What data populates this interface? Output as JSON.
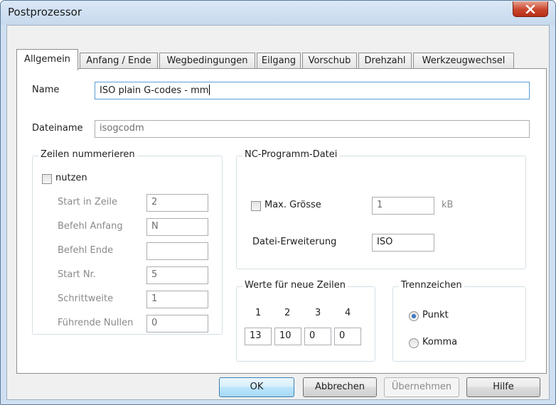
{
  "window": {
    "title": "Postprozessor"
  },
  "tabs": [
    {
      "label": "Allgemein",
      "active": true
    },
    {
      "label": "Anfang / Ende"
    },
    {
      "label": "Wegbedingungen"
    },
    {
      "label": "Eilgang"
    },
    {
      "label": "Vorschub"
    },
    {
      "label": "Drehzahl"
    },
    {
      "label": "Werkzeugwechsel"
    }
  ],
  "general": {
    "name_label": "Name",
    "name_value": "ISO plain G-codes - mm",
    "filename_label": "Dateiname",
    "filename_value": "isogcodm"
  },
  "line_numbering": {
    "title": "Zeilen nummerieren",
    "use_label": "nutzen",
    "use_checked": false,
    "fields": [
      {
        "label": "Start in Zeile",
        "value": "2"
      },
      {
        "label": "Befehl Anfang",
        "value": "N"
      },
      {
        "label": "Befehl Ende",
        "value": ""
      },
      {
        "label": "Start Nr.",
        "value": "5"
      },
      {
        "label": "Schrittweite",
        "value": "1"
      },
      {
        "label": "Führende Nullen",
        "value": "0"
      }
    ]
  },
  "nc_file": {
    "title": "NC-Programm-Datei",
    "max_size_label": "Max. Grösse",
    "max_size_checked": false,
    "max_size_value": "1",
    "max_size_unit": "kB",
    "extension_label": "Datei-Erweiterung",
    "extension_value": "ISO"
  },
  "new_lines": {
    "title": "Werte für neue Zeilen",
    "headers": [
      "1",
      "2",
      "3",
      "4"
    ],
    "values": [
      "13",
      "10",
      "0",
      "0"
    ]
  },
  "separator": {
    "title": "Trennzeichen",
    "options": [
      {
        "label": "Punkt",
        "checked": true
      },
      {
        "label": "Komma",
        "checked": false
      }
    ]
  },
  "buttons": {
    "ok": "OK",
    "cancel": "Abbrechen",
    "apply": "Übernehmen",
    "help": "Hilfe"
  },
  "colors": {
    "title_bar": "#cfe0f2",
    "close_button": "#c9452b",
    "focus_border": "#5c9ed6",
    "default_button": "#bee6fd"
  }
}
